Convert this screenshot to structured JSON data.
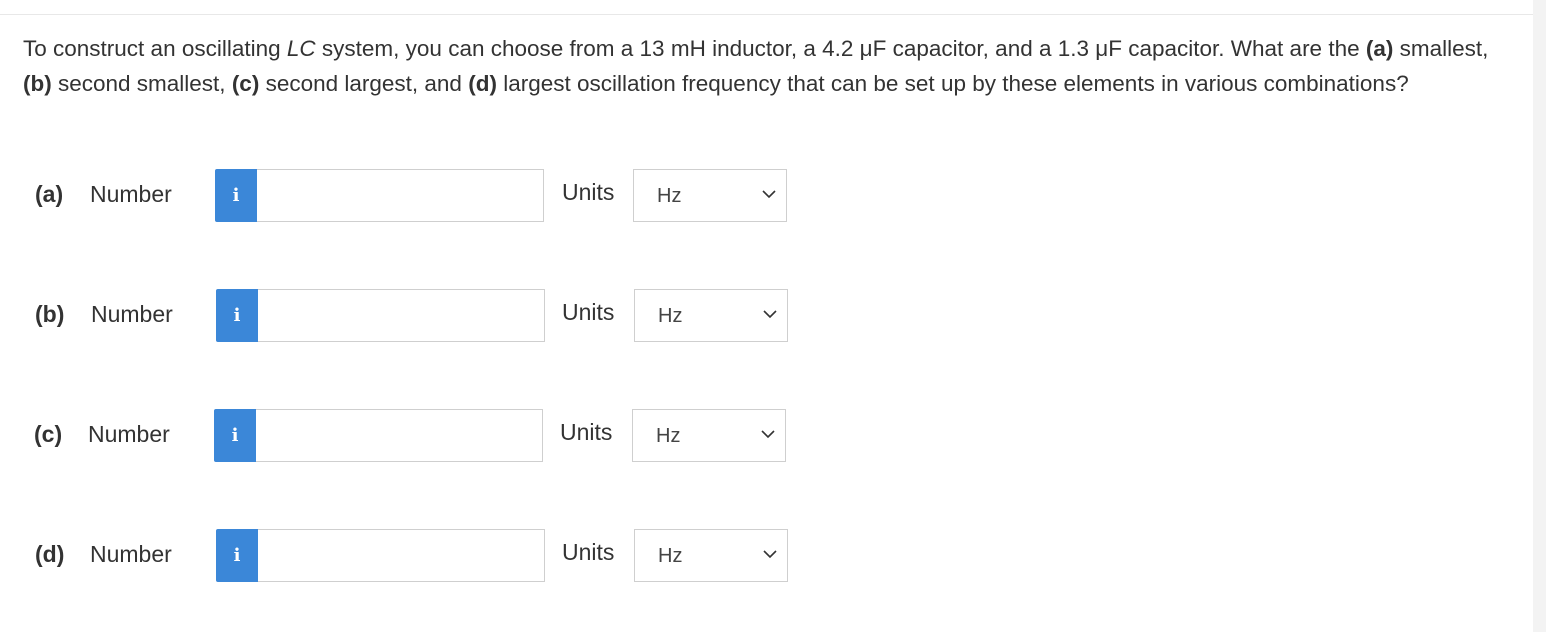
{
  "question": {
    "part1": "To construct an oscillating ",
    "italic": "LC",
    "part2": " system, you can choose from a 13 mH inductor, a 4.2 μF capacitor, and a 1.3 μF capacitor. What are the ",
    "a": "(a)",
    "part3": " smallest, ",
    "b": "(b)",
    "part4": " second smallest, ",
    "c": "(c)",
    "part5": " second largest, and ",
    "d": "(d)",
    "part6": " largest oscillation frequency that can be set up by these elements in various combinations?"
  },
  "rows": [
    {
      "part": "(a)",
      "number_label": "Number",
      "info": "i",
      "value": "",
      "units_label": "Units",
      "unit": "Hz"
    },
    {
      "part": "(b)",
      "number_label": "Number",
      "info": "i",
      "value": "",
      "units_label": "Units",
      "unit": "Hz"
    },
    {
      "part": "(c)",
      "number_label": "Number",
      "info": "i",
      "value": "",
      "units_label": "Units",
      "unit": "Hz"
    },
    {
      "part": "(d)",
      "number_label": "Number",
      "info": "i",
      "value": "",
      "units_label": "Units",
      "unit": "Hz"
    }
  ],
  "colors": {
    "info_button": "#3b87d8",
    "text": "#333333",
    "border": "#cfcfcf"
  },
  "icons": {
    "info": "info-icon",
    "dropdown": "chevron-down-icon"
  }
}
